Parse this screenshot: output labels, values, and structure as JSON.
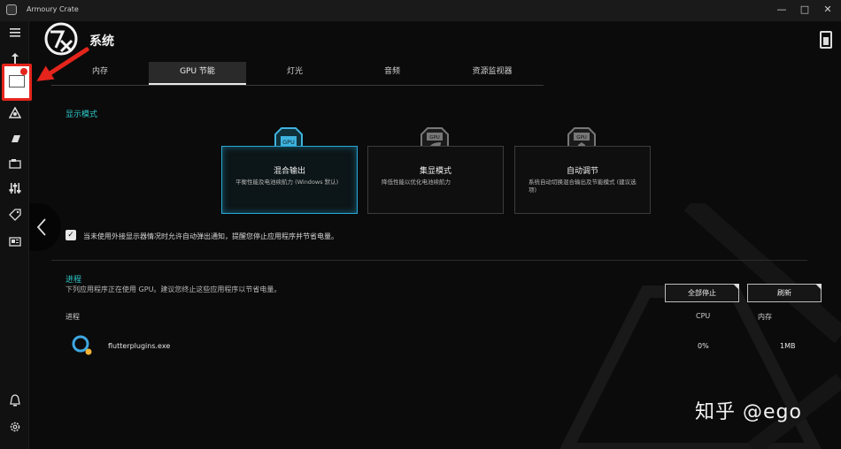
{
  "window": {
    "title": "Armoury Crate",
    "minimize": "—",
    "maximize": "□",
    "close": "✕"
  },
  "header": {
    "title": "系统"
  },
  "tabs": [
    {
      "label": "内存"
    },
    {
      "label": "GPU 节能"
    },
    {
      "label": "灯光"
    },
    {
      "label": "音频"
    },
    {
      "label": "资源监视器"
    }
  ],
  "display_mode": {
    "label": "显示模式",
    "icon_text": "GPU",
    "cards": [
      {
        "title": "混合输出",
        "desc": "平衡性能及电池续航力 (Windows 默认)"
      },
      {
        "title": "集显模式",
        "desc": "降低性能以优化电池续航力"
      },
      {
        "title": "自动调节",
        "desc": "系统自动切换混合输出及节能模式 (建议选项)"
      }
    ]
  },
  "notification": {
    "checkmark": "✓",
    "label": "当未使用外接显示器情况时允许自动弹出通知，提醒您停止应用程序并节省电量。"
  },
  "process": {
    "label": "进程",
    "desc": "下列应用程序正在使用 GPU。建议您终止这些应用程序以节省电量。",
    "stop_all": "全部停止",
    "refresh": "刷新",
    "col_process": "进程",
    "col_cpu": "CPU",
    "col_mem": "内存",
    "rows": [
      {
        "name": "flutterplugins.exe",
        "cpu": "0%",
        "mem": "1MB"
      }
    ]
  },
  "watermark": "知乎 @ego",
  "colors": {
    "accent": "#2ec9c9",
    "highlight": "#28a7d6",
    "annotation": "#e5251c"
  }
}
